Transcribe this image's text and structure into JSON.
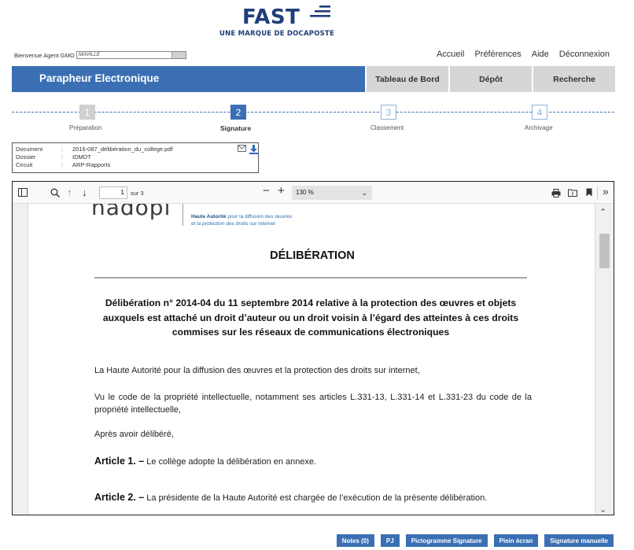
{
  "brand": {
    "name": "FAST",
    "tagline": "UNE MARQUE DE DOCAPOSTE",
    "color": "#1f3d7a"
  },
  "user": {
    "welcome": "Bienvenue Agent GMO",
    "selected": "MAVILLE"
  },
  "top_links": [
    "Accueil",
    "Préférences",
    "Aide",
    "Déconnexion"
  ],
  "app_title": "Parapheur Electronique",
  "accent_color": "#3a6fb3",
  "nav_tabs": [
    "Tableau de Bord",
    "Dépôt",
    "Recherche"
  ],
  "steps": [
    {
      "number": "1",
      "label": "Préparation",
      "state": "done"
    },
    {
      "number": "2",
      "label": "Signature",
      "state": "active"
    },
    {
      "number": "3",
      "label": "Classement",
      "state": "todo"
    },
    {
      "number": "4",
      "label": "Archivage",
      "state": "todo"
    }
  ],
  "doc_info": {
    "document_label": "Document",
    "document_value": "2016-087_délibération_du_college.pdf",
    "dossier_label": "Dossier",
    "dossier_value": "IDMDT",
    "circuit_label": "Circuit",
    "circuit_value": "ARP-Rapports",
    "separator": ":",
    "icons": [
      "mail-icon",
      "download-icon"
    ]
  },
  "viewer": {
    "page_number": "1",
    "page_of": "sur 3",
    "zoom": "130 %"
  },
  "pdf": {
    "logo_text": "hadopi",
    "authority_line1_bold": "Haute Autorité",
    "authority_line1_rest": " pour la diffusion des œuvres",
    "authority_line2": "et la protection des droits sur internet",
    "title": "DÉLIBÉRATION",
    "subtitle": "Délibération n° 2014-04 du 11 septembre 2014 relative à la protection des œuvres et objets auxquels est attaché un droit d’auteur ou un droit voisin à l’égard des atteintes à ces droits commises sur les réseaux de communications électroniques",
    "para1": "La Haute Autorité pour la diffusion des œuvres et la protection des droits sur internet,",
    "para2": "Vu le code de la propriété intellectuelle, notamment ses articles L.331-13, L.331-14 et L.331-23 du code de la propriété intellectuelle,",
    "para3": "Après avoir délibéré,",
    "article1_label": "Article 1. –",
    "article1_text": " Le collège adopte la délibération en annexe.",
    "article2_label": "Article 2. –",
    "article2_text": " La présidente de la Haute Autorité est chargée de l’exécution de la présente délibération."
  },
  "buttons": [
    "Notes (0)",
    "PJ",
    "Pictogramme Signature",
    "Plein écran",
    "Signature manuelle"
  ]
}
